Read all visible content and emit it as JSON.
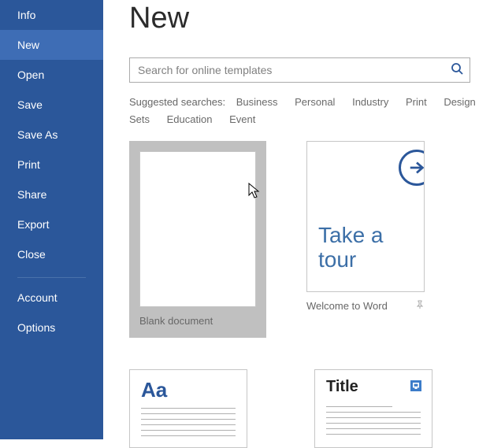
{
  "sidebar": {
    "items": [
      {
        "label": "Info"
      },
      {
        "label": "New",
        "active": true
      },
      {
        "label": "Open"
      },
      {
        "label": "Save"
      },
      {
        "label": "Save As"
      },
      {
        "label": "Print"
      },
      {
        "label": "Share"
      },
      {
        "label": "Export"
      },
      {
        "label": "Close"
      }
    ],
    "footer": [
      {
        "label": "Account"
      },
      {
        "label": "Options"
      }
    ]
  },
  "page": {
    "title": "New"
  },
  "search": {
    "placeholder": "Search for online templates"
  },
  "suggested": {
    "label": "Suggested searches:",
    "items": [
      "Business",
      "Personal",
      "Industry",
      "Print",
      "Design Sets",
      "Education",
      "Event"
    ]
  },
  "templates": {
    "blank": {
      "caption": "Blank document"
    },
    "tour": {
      "line1": "Take a",
      "line2": "tour",
      "caption": "Welcome to Word"
    },
    "spacing": {
      "thumb_text": "Aa"
    },
    "title": {
      "thumb_text": "Title"
    }
  }
}
